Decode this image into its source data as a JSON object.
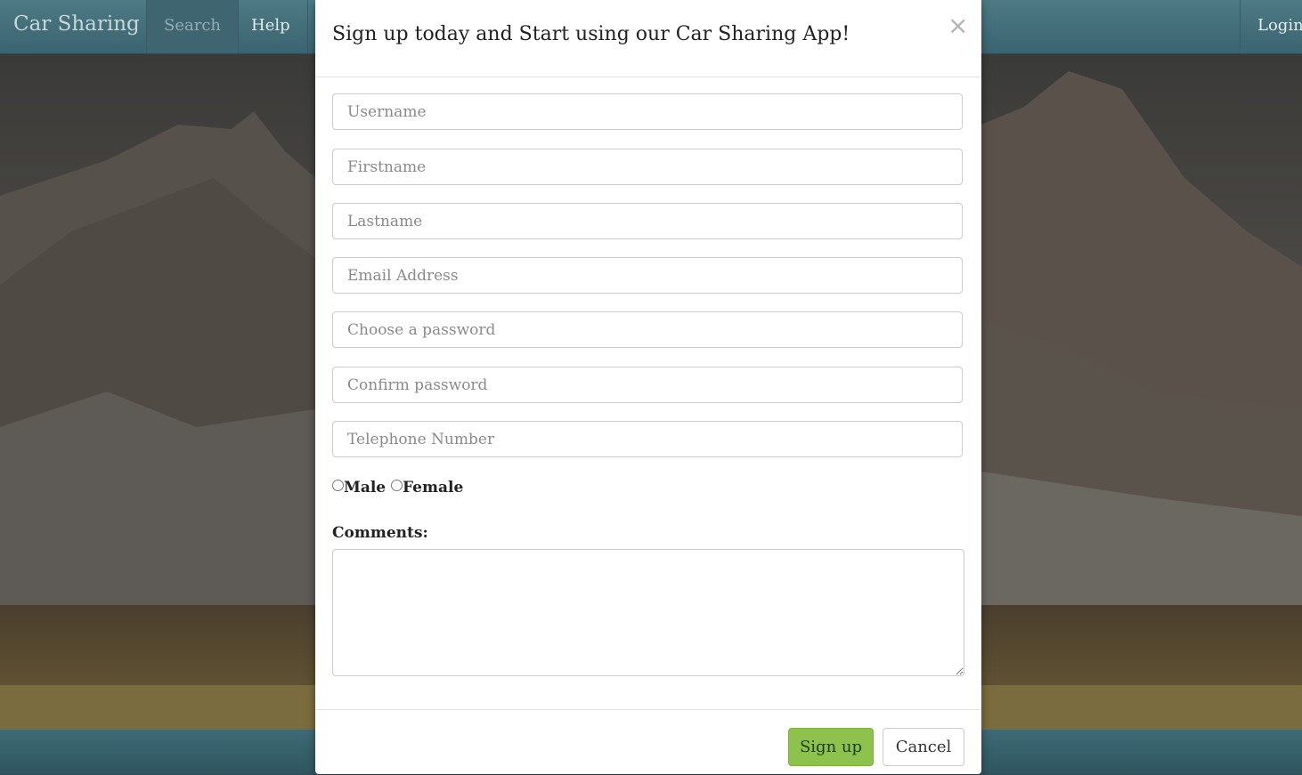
{
  "navbar": {
    "brand": "Car Sharing",
    "search": "Search",
    "help": "Help",
    "login": "Login"
  },
  "modal": {
    "title": "Sign up today and Start using our Car Sharing App!",
    "close_symbol": "×",
    "fields": {
      "username": "Username",
      "firstname": "Firstname",
      "lastname": "Lastname",
      "email": "Email Address",
      "password": "Choose a password",
      "confirm_password": "Confirm password",
      "telephone": "Telephone Number"
    },
    "gender": {
      "male": "Male",
      "female": "Female"
    },
    "comments_label": "Comments:",
    "comments_value": "",
    "buttons": {
      "signup": "Sign up",
      "cancel": "Cancel"
    }
  },
  "colors": {
    "navbar": "#3f6670",
    "signup_button": "#8dc24c",
    "modal_background": "#ffffff"
  }
}
